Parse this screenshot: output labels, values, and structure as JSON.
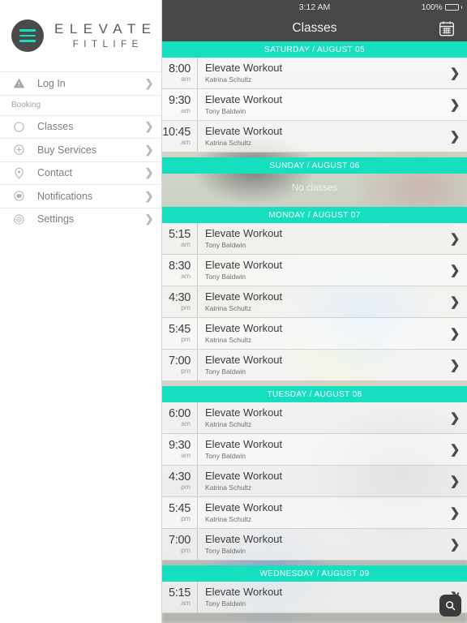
{
  "sidebar": {
    "logo": {
      "name": "ELEVATE",
      "sub": "FITLIFE",
      "icon": "hamburger-logo-icon"
    },
    "login": {
      "label": "Log In",
      "icon": "warning-triangle-icon"
    },
    "section_label": "Booking",
    "items": [
      {
        "label": "Classes",
        "icon": "circle-icon"
      },
      {
        "label": "Buy Services",
        "icon": "plus-circle-icon"
      },
      {
        "label": "Contact",
        "icon": "location-pin-icon"
      },
      {
        "label": "Notifications",
        "icon": "chat-bubble-icon"
      },
      {
        "label": "Settings",
        "icon": "gear-icon"
      }
    ],
    "chevron": "❯"
  },
  "statusbar": {
    "time": "3:12 AM",
    "battery_percent": "100%"
  },
  "navbar": {
    "title": "Classes",
    "calendar_icon": "calendar-icon"
  },
  "colors": {
    "accent_teal": "#16dfbf",
    "navbar_gray": "#474747",
    "text_dark": "#3c3c3c"
  },
  "search": {
    "icon": "search-icon"
  },
  "schedule": [
    {
      "day_label": "SATURDAY / AUGUST 05",
      "no_classes_text": null,
      "classes": [
        {
          "time": "8:00",
          "ampm": "am",
          "name": "Elevate Workout",
          "instructor": "Katrina Schultz"
        },
        {
          "time": "9:30",
          "ampm": "am",
          "name": "Elevate Workout",
          "instructor": "Tony Baldwin"
        },
        {
          "time": "10:45",
          "ampm": "am",
          "name": "Elevate Workout",
          "instructor": "Katrina Schultz"
        }
      ]
    },
    {
      "day_label": "SUNDAY / AUGUST 06",
      "no_classes_text": "No classes",
      "classes": []
    },
    {
      "day_label": "MONDAY / AUGUST 07",
      "no_classes_text": null,
      "classes": [
        {
          "time": "5:15",
          "ampm": "am",
          "name": "Elevate Workout",
          "instructor": "Tony Baldwin"
        },
        {
          "time": "8:30",
          "ampm": "am",
          "name": "Elevate Workout",
          "instructor": "Tony Baldwin"
        },
        {
          "time": "4:30",
          "ampm": "pm",
          "name": "Elevate Workout",
          "instructor": "Katrina Schultz"
        },
        {
          "time": "5:45",
          "ampm": "pm",
          "name": "Elevate Workout",
          "instructor": "Katrina Schultz"
        },
        {
          "time": "7:00",
          "ampm": "pm",
          "name": "Elevate Workout",
          "instructor": "Tony Baldwin"
        }
      ]
    },
    {
      "day_label": "TUESDAY / AUGUST 08",
      "no_classes_text": null,
      "classes": [
        {
          "time": "6:00",
          "ampm": "am",
          "name": "Elevate Workout",
          "instructor": "Katrina Schultz"
        },
        {
          "time": "9:30",
          "ampm": "am",
          "name": "Elevate Workout",
          "instructor": "Tony Baldwin"
        },
        {
          "time": "4:30",
          "ampm": "pm",
          "name": "Elevate Workout",
          "instructor": "Katrina Schultz"
        },
        {
          "time": "5:45",
          "ampm": "pm",
          "name": "Elevate Workout",
          "instructor": "Katrina Schultz"
        },
        {
          "time": "7:00",
          "ampm": "pm",
          "name": "Elevate Workout",
          "instructor": "Tony Baldwin"
        }
      ]
    },
    {
      "day_label": "WEDNESDAY / AUGUST 09",
      "no_classes_text": null,
      "classes": [
        {
          "time": "5:15",
          "ampm": "am",
          "name": "Elevate Workout",
          "instructor": "Tony Baldwin"
        }
      ]
    }
  ]
}
